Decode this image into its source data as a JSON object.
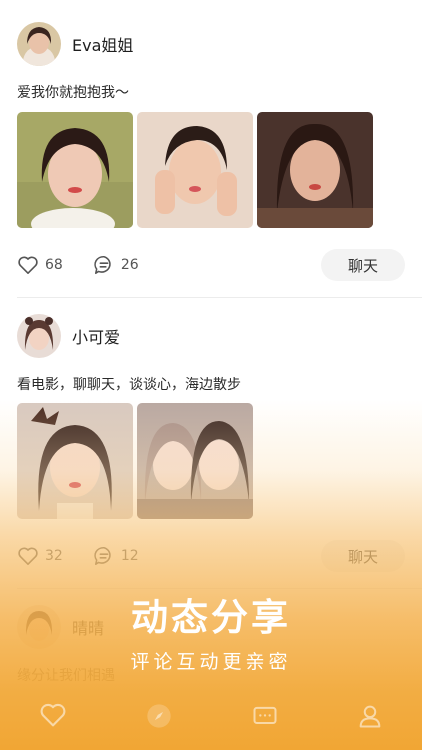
{
  "posts": [
    {
      "username": "Eva姐姐",
      "text": "爱我你就抱抱我～",
      "likes": "68",
      "comments": "26",
      "chat_label": "聊天"
    },
    {
      "username": "小可爱",
      "text": "看电影，聊聊天，谈谈心，海边散步",
      "likes": "32",
      "comments": "12",
      "chat_label": "聊天"
    },
    {
      "username": "晴晴",
      "text": "缘分让我们相遇"
    }
  ],
  "promo": {
    "title": "动态分享",
    "subtitle": "评论互动更亲密"
  },
  "tabbar": {
    "icons": [
      "heart-icon",
      "compass-icon",
      "message-icon",
      "profile-icon"
    ]
  },
  "colors": {
    "accent_orange": "#f1a634",
    "chat_button_bg": "#f3f3f3",
    "divider": "#ececec"
  }
}
